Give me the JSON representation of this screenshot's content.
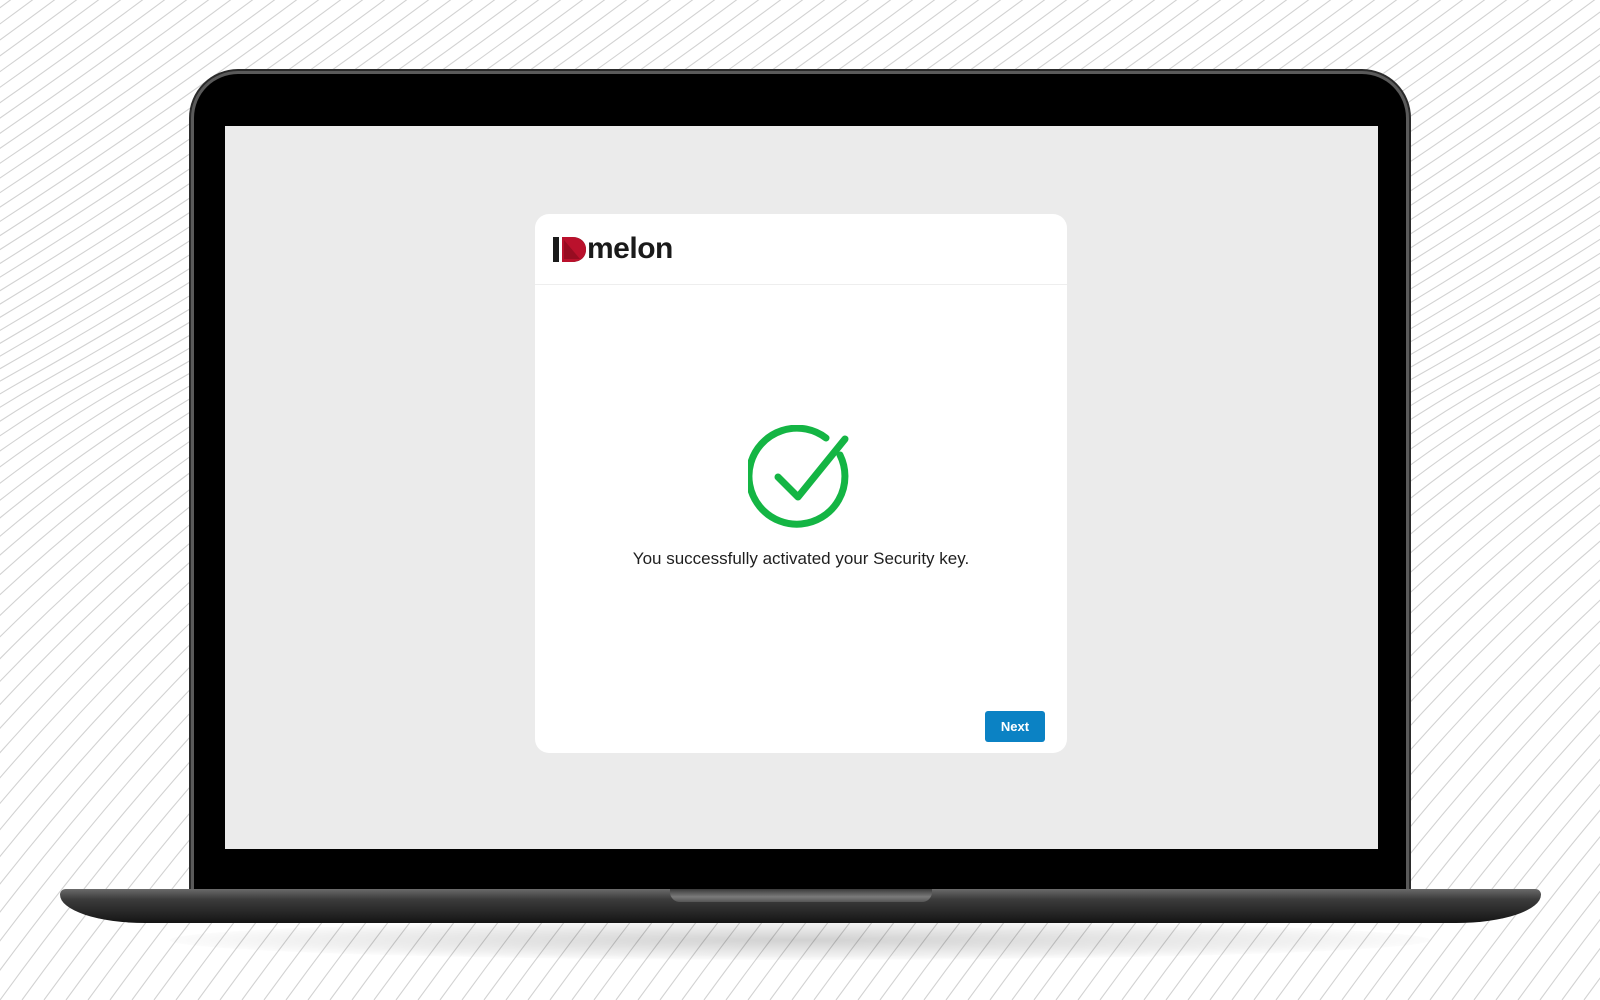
{
  "brand": {
    "name": "melon",
    "logo_letter": "I",
    "accent_color": "#c8102e"
  },
  "dialog": {
    "status_icon": "check-circle-icon",
    "status_color": "#14b544",
    "message": "You successfully activated your Security key.",
    "next_label": "Next",
    "button_color": "#0b82c4"
  },
  "device": {
    "frame": "laptop"
  }
}
